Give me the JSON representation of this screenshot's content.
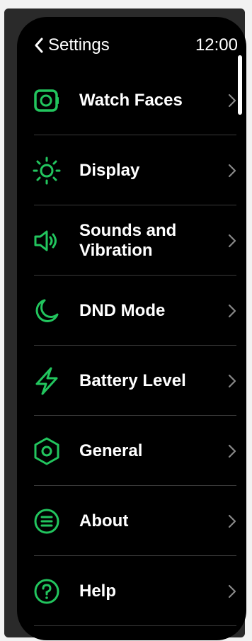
{
  "header": {
    "back_label": "Settings",
    "time": "12:00"
  },
  "accent": "#22c55e",
  "menu": [
    {
      "label": "Watch Faces",
      "icon": "watch-face-icon"
    },
    {
      "label": "Display",
      "icon": "sun-icon"
    },
    {
      "label": "Sounds and Vibration",
      "icon": "speaker-icon"
    },
    {
      "label": "DND Mode",
      "icon": "moon-icon"
    },
    {
      "label": "Battery Level",
      "icon": "lightning-icon"
    },
    {
      "label": "General",
      "icon": "hexagon-settings-icon"
    },
    {
      "label": "About",
      "icon": "info-lines-icon"
    },
    {
      "label": "Help",
      "icon": "help-icon"
    }
  ]
}
